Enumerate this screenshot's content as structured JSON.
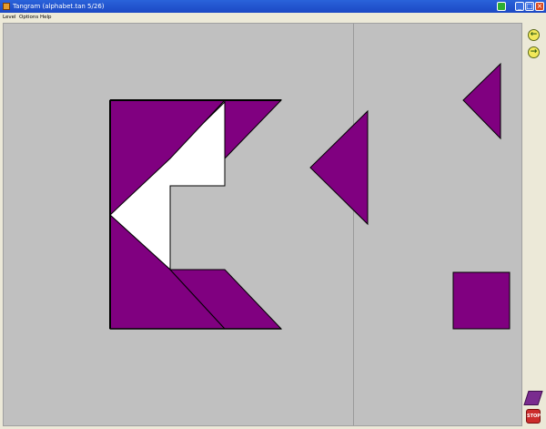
{
  "window": {
    "title": "Tangram (alphabet.tan    5/26)"
  },
  "menu": [
    "Level",
    "Options",
    "Help"
  ],
  "toolbar": {
    "prev_icon": "left-arrow-icon",
    "next_icon": "right-arrow-icon",
    "stop_label": "STOP"
  },
  "colors": {
    "piece": "#800080",
    "outline": "#000000",
    "silhouette": "#FFFFFF",
    "canvas": "#C0C0C0"
  }
}
